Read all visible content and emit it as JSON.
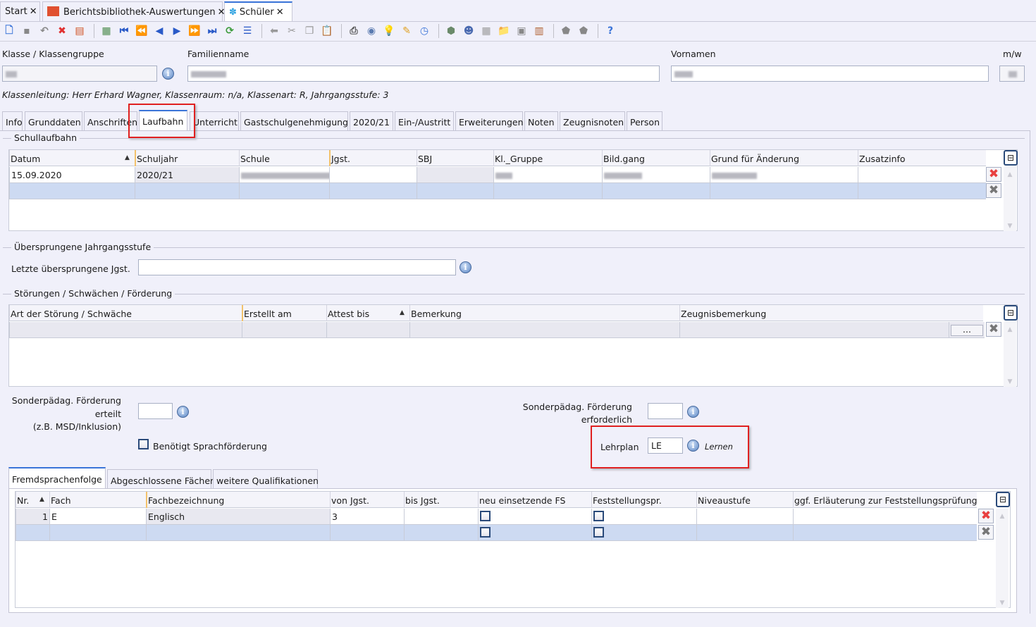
{
  "doc_tabs": [
    {
      "label": "Start",
      "icon": "",
      "close": "✕"
    },
    {
      "label": "Berichtsbibliothek-Auswertungen",
      "icon": "report-library-icon",
      "close": "✕"
    },
    {
      "label": "Schüler",
      "icon": "students-icon",
      "close": "✕",
      "active": true
    }
  ],
  "toolbar": {
    "groups": [
      [
        {
          "icon": "new-record-icon",
          "glyph": "🗋",
          "color": "#3a74d8"
        },
        {
          "icon": "save-icon",
          "glyph": "▪",
          "color": "#888"
        },
        {
          "icon": "undo-icon",
          "glyph": "↶",
          "color": "#888"
        },
        {
          "icon": "delete-icon",
          "glyph": "✖",
          "color": "#e03030"
        },
        {
          "icon": "cancel-edit-icon",
          "glyph": "▤",
          "color": "#d05020"
        }
      ],
      [
        {
          "icon": "clipboard-table-icon",
          "glyph": "▦",
          "color": "#4a8a4a"
        },
        {
          "icon": "first-record-icon",
          "glyph": "⏮",
          "color": "#2a5ac8"
        },
        {
          "icon": "previous-page-icon",
          "glyph": "⏪",
          "color": "#2a5ac8"
        },
        {
          "icon": "previous-record-icon",
          "glyph": "◀",
          "color": "#2a5ac8"
        },
        {
          "icon": "next-record-icon",
          "glyph": "▶",
          "color": "#2a5ac8"
        },
        {
          "icon": "next-page-icon",
          "glyph": "⏩",
          "color": "#2a5ac8"
        },
        {
          "icon": "last-record-icon",
          "glyph": "⏭",
          "color": "#2a5ac8"
        },
        {
          "icon": "refresh-icon",
          "glyph": "⟳",
          "color": "#3a9a3a"
        },
        {
          "icon": "list-icon",
          "glyph": "☰",
          "color": "#2a5ac8"
        }
      ],
      [
        {
          "icon": "back-arrow-icon",
          "glyph": "⬅",
          "color": "#999"
        },
        {
          "icon": "cut-icon",
          "glyph": "✂",
          "color": "#999"
        },
        {
          "icon": "copy-icon",
          "glyph": "❐",
          "color": "#999"
        },
        {
          "icon": "paste-icon",
          "glyph": "📋",
          "color": "#c89030"
        }
      ],
      [
        {
          "icon": "print-icon",
          "glyph": "⎙",
          "color": "#555"
        },
        {
          "icon": "preview-icon",
          "glyph": "◉",
          "color": "#5a7ab0"
        },
        {
          "icon": "lightbulb-icon",
          "glyph": "💡",
          "color": "#e0b020"
        },
        {
          "icon": "tag-icon",
          "glyph": "✎",
          "color": "#e0a020"
        },
        {
          "icon": "clock-icon",
          "glyph": "◷",
          "color": "#3a74d8"
        }
      ],
      [
        {
          "icon": "export-icon",
          "glyph": "⬢",
          "color": "#6a8a6a"
        },
        {
          "icon": "user-icon",
          "glyph": "☻",
          "color": "#4a6ab0"
        },
        {
          "icon": "grid-disabled-icon",
          "glyph": "▦",
          "color": "#999"
        },
        {
          "icon": "folder-icon",
          "glyph": "📁",
          "color": "#d0a030"
        },
        {
          "icon": "card-icon",
          "glyph": "▣",
          "color": "#888"
        },
        {
          "icon": "film-icon",
          "glyph": "▥",
          "color": "#b06030"
        }
      ],
      [
        {
          "icon": "filter-icon",
          "glyph": "⬟",
          "color": "#888"
        },
        {
          "icon": "filter-remove-icon",
          "glyph": "⬟",
          "color": "#888"
        }
      ],
      [
        {
          "icon": "help-icon",
          "glyph": "?",
          "color": "#3a74d8"
        }
      ]
    ]
  },
  "header": {
    "klasse_label": "Klasse / Klassengruppe",
    "familienname_label": "Familienname",
    "vornamen_label": "Vornamen",
    "mw_label": "m/w",
    "info_line": "Klassenleitung: Herr Erhard Wagner, Klassenraum: n/a, Klassenart: R, Jahrgangsstufe: 3"
  },
  "tabs": [
    "Info",
    "Grunddaten",
    "Anschriften",
    "Laufbahn",
    "Unterricht",
    "Gastschulgenehmigung",
    "2020/21",
    "Ein-/Austritt",
    "Erweiterungen",
    "Noten",
    "Zeugnisnoten",
    "Person"
  ],
  "active_tab": "Laufbahn",
  "schullaufbahn": {
    "legend": "Schullaufbahn",
    "columns": [
      "Datum",
      "Schuljahr",
      "Schule",
      "Jgst.",
      "SBJ",
      "Kl._Gruppe",
      "Bild.gang",
      "Grund für Änderung",
      "Zusatzinfo"
    ],
    "rows": [
      [
        "15.09.2020",
        "2020/21",
        "",
        "",
        "",
        "",
        "",
        "",
        ""
      ]
    ]
  },
  "uebersprungen": {
    "legend": "Übersprungene Jahrgangsstufe",
    "label": "Letzte übersprungene Jgst.",
    "value": ""
  },
  "stoerungen": {
    "legend": "Störungen / Schwächen / Förderung",
    "columns": [
      "Art der Störung / Schwäche",
      "Erstellt am",
      "Attest bis",
      "Bemerkung",
      "Zeugnisbemerkung"
    ],
    "ellipsis": "..."
  },
  "foerderung": {
    "erteilt_label": [
      "Sonderpädag. Förderung",
      "erteilt",
      "(z.B. MSD/Inklusion)"
    ],
    "erteilt_value": "",
    "erforderlich_label": [
      "Sonderpädag. Förderung",
      "erforderlich"
    ],
    "erforderlich_value": "",
    "sprachfoerderung_label": "Benötigt Sprachförderung",
    "sprachfoerderung_checked": false,
    "lehrplan_label": "Lehrplan",
    "lehrplan_value": "LE",
    "lehrplan_text": "Lernen"
  },
  "subtabs": [
    "Fremdsprachenfolge",
    "Abgeschlossene Fächer",
    "weitere Qualifikationen"
  ],
  "fremdsprachen": {
    "columns": [
      "Nr.",
      "Fach",
      "Fachbezeichnung",
      "von Jgst.",
      "bis Jgst.",
      "neu einsetzende FS",
      "Feststellungspr.",
      "Niveaustufe",
      "ggf. Erläuterung zur Feststellungsprüfung"
    ],
    "rows": [
      [
        "1",
        "E",
        "Englisch",
        "3",
        "",
        false,
        false,
        "",
        ""
      ]
    ]
  },
  "colors": {
    "accent": "#3a74d8",
    "highlight": "#e02020",
    "new_row": "#cddaf2"
  }
}
